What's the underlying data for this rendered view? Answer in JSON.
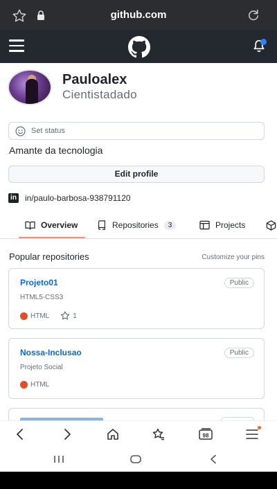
{
  "browser": {
    "url": "github.com"
  },
  "profile": {
    "name": "Pauloalex",
    "login": "Cientistadado",
    "status_label": "Set status",
    "bio": "Amante da tecnologia",
    "edit_label": "Edit profile",
    "linkedin": "in/paulo-barbosa-938791120"
  },
  "tabs": [
    {
      "label": "Overview"
    },
    {
      "label": "Repositories",
      "count": "3"
    },
    {
      "label": "Projects"
    }
  ],
  "pinned": {
    "heading": "Popular repositories",
    "customize_label": "Customize your pins",
    "repos": [
      {
        "name": "Projeto01",
        "visibility": "Public",
        "description": "HTML5-CSS3",
        "language": "HTML",
        "lang_color": "#e34c26",
        "stars": "1"
      },
      {
        "name": "Nossa-Inclusao",
        "visibility": "Public",
        "description": "Projeto Social",
        "language": "HTML",
        "lang_color": "#e34c26"
      }
    ]
  },
  "browser_nav": {
    "tabs_count": "98"
  }
}
